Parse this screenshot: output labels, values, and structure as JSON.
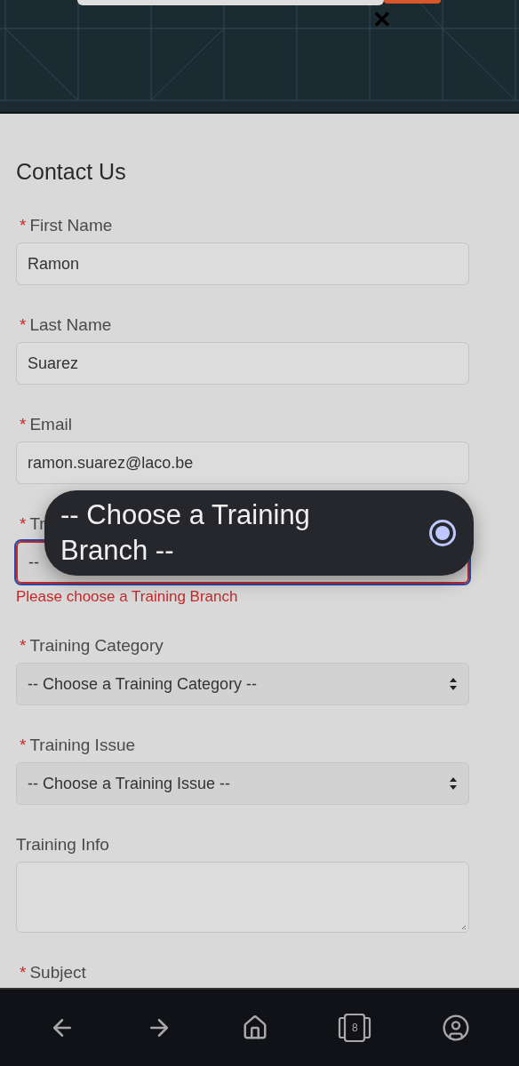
{
  "header": {
    "close": "✕"
  },
  "form": {
    "title": "Contact Us",
    "fields": [
      {
        "label": "First Name",
        "mark": "*",
        "kind": "text",
        "value": "Ramon",
        "invalid": false
      },
      {
        "label": "Last Name",
        "mark": "*",
        "kind": "text",
        "value": "Suarez",
        "invalid": false
      },
      {
        "label": "Email",
        "mark": "*",
        "kind": "text",
        "value": "ramon.suarez@laco.be",
        "invalid": false
      },
      {
        "label": "Tr",
        "mark": "*",
        "kind": "select",
        "value": "--",
        "invalid": true,
        "error": "Please choose a Training Branch"
      },
      {
        "label": "Training Category",
        "mark": "*",
        "kind": "select",
        "value": "-- Choose a Training Category --",
        "invalid": false,
        "arrows": true
      },
      {
        "label": "Training Issue",
        "mark": "*",
        "kind": "select",
        "value": "-- Choose a Training Issue --",
        "invalid": false,
        "arrows": true
      },
      {
        "label": "Training Info",
        "kind": "textarea",
        "invalid": false
      },
      {
        "label": "Subject",
        "mark": "*"
      }
    ]
  },
  "dropdown": {
    "options": [
      {
        "label": "-- Choose a Training Branch --",
        "selected": true
      }
    ]
  },
  "nav": {
    "tab_count": "8"
  }
}
